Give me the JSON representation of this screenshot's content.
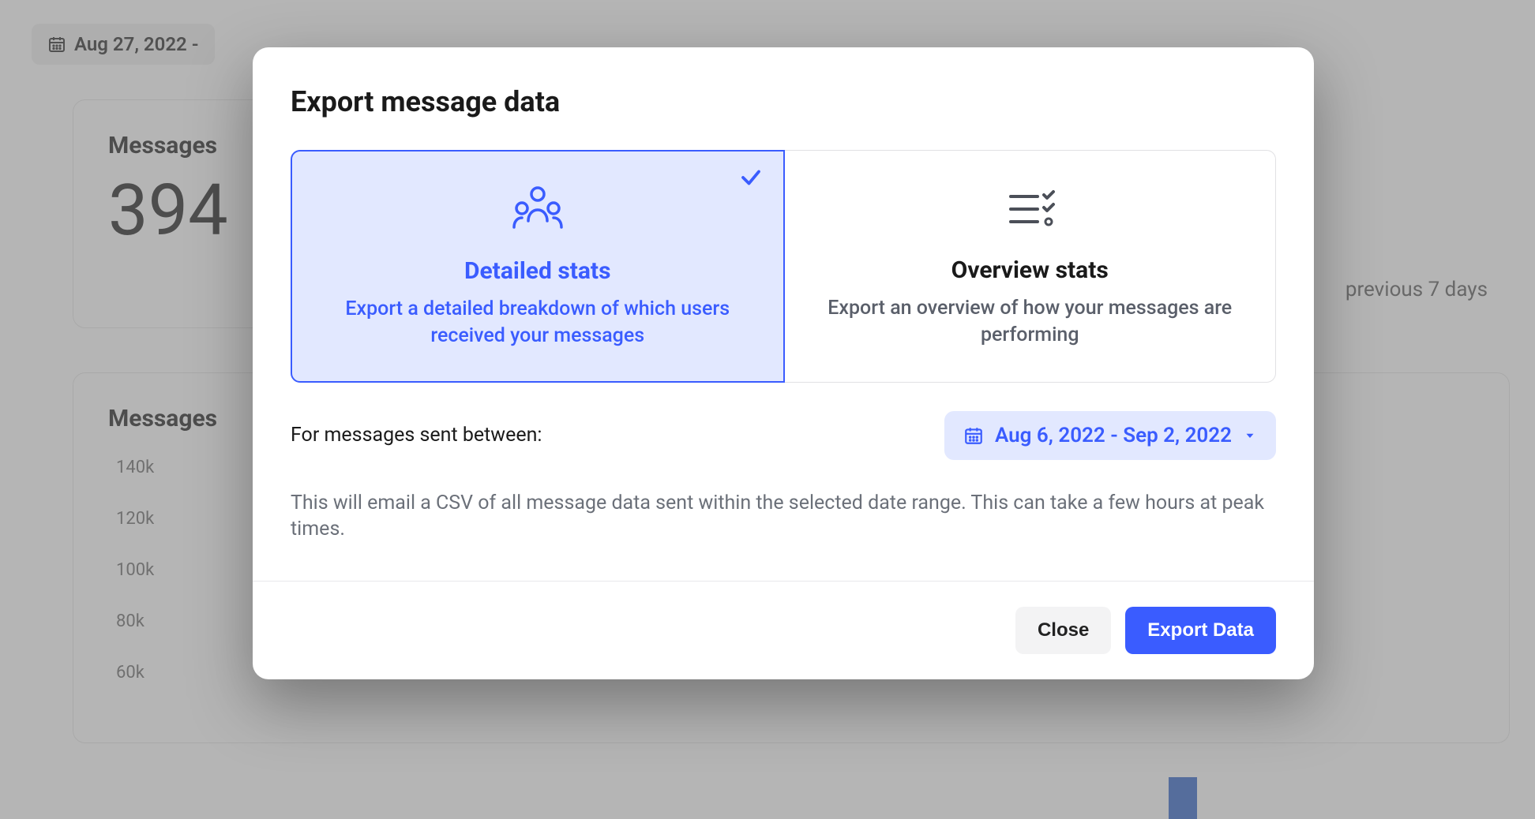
{
  "background": {
    "date_range_button": "Aug 27, 2022 -",
    "card1_title": "Messages",
    "card1_number": "394",
    "prev_days": "previous 7 days",
    "card2_title": "Messages",
    "ticks": [
      "140k",
      "120k",
      "100k",
      "80k",
      "60k"
    ]
  },
  "modal": {
    "title": "Export message data",
    "options": {
      "detailed": {
        "title": "Detailed stats",
        "desc": "Export a detailed breakdown of which users received your messages"
      },
      "overview": {
        "title": "Overview stats",
        "desc": "Export an overview of how your messages are performing"
      }
    },
    "date_label": "For messages sent between:",
    "date_picker_value": "Aug 6, 2022 - Sep 2, 2022",
    "helper_text": "This will email a CSV of all message data sent within the selected date range. This can take a few hours at peak times.",
    "close_button": "Close",
    "export_button": "Export Data"
  }
}
